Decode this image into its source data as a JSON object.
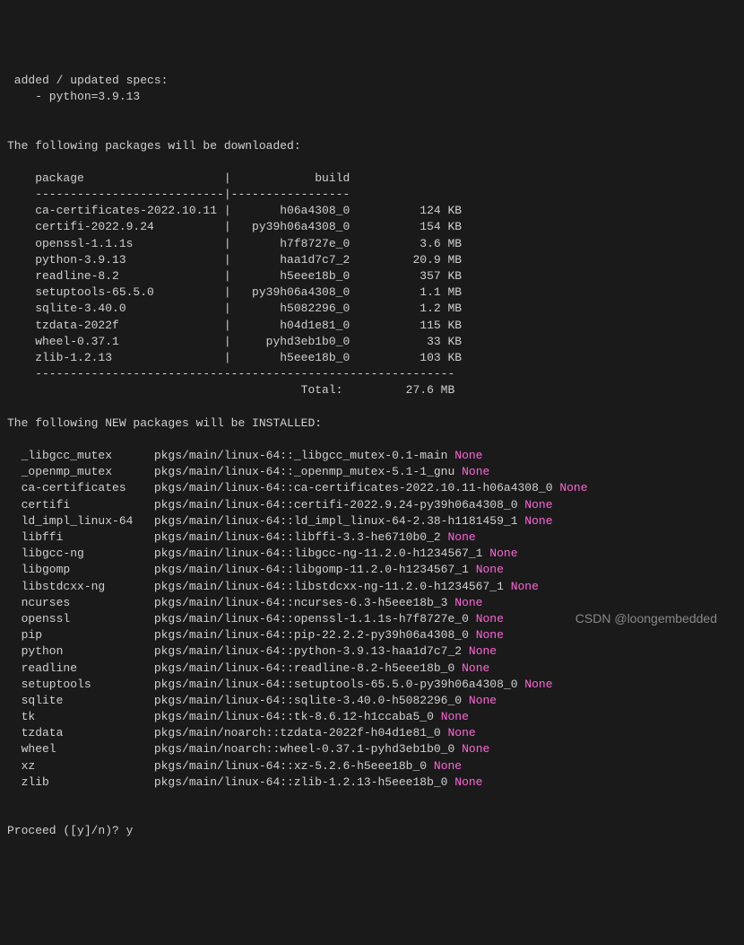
{
  "header": {
    "specs_line": " added / updated specs:",
    "spec_item": "    - python=3.9.13"
  },
  "download": {
    "intro": "The following packages will be downloaded:",
    "col_package": "    package",
    "col_build": "build",
    "dash_left": "    ---------------------------",
    "dash_right": "-----------------",
    "rows": [
      {
        "pkg": "    ca-certificates-2022.10.11",
        "build": "h06a4308_0",
        "size": "124 KB"
      },
      {
        "pkg": "    certifi-2022.9.24",
        "build": "py39h06a4308_0",
        "size": "154 KB"
      },
      {
        "pkg": "    openssl-1.1.1s",
        "build": "h7f8727e_0",
        "size": "3.6 MB"
      },
      {
        "pkg": "    python-3.9.13",
        "build": "haa1d7c7_2",
        "size": "20.9 MB"
      },
      {
        "pkg": "    readline-8.2",
        "build": "h5eee18b_0",
        "size": "357 KB"
      },
      {
        "pkg": "    setuptools-65.5.0",
        "build": "py39h06a4308_0",
        "size": "1.1 MB"
      },
      {
        "pkg": "    sqlite-3.40.0",
        "build": "h5082296_0",
        "size": "1.2 MB"
      },
      {
        "pkg": "    tzdata-2022f",
        "build": "h04d1e81_0",
        "size": "115 KB"
      },
      {
        "pkg": "    wheel-0.37.1",
        "build": "pyhd3eb1b0_0",
        "size": "33 KB"
      },
      {
        "pkg": "    zlib-1.2.13",
        "build": "h5eee18b_0",
        "size": "103 KB"
      }
    ],
    "bottom_dash": "    ------------------------------------------------------------",
    "total_label": "Total:",
    "total_value": "27.6 MB"
  },
  "install": {
    "intro": "The following NEW packages will be INSTALLED:",
    "rows": [
      {
        "name": "  _libgcc_mutex",
        "src": "pkgs/main/linux-64::_libgcc_mutex-0.1-main",
        "tag": "None"
      },
      {
        "name": "  _openmp_mutex",
        "src": "pkgs/main/linux-64::_openmp_mutex-5.1-1_gnu",
        "tag": "None"
      },
      {
        "name": "  ca-certificates",
        "src": "pkgs/main/linux-64::ca-certificates-2022.10.11-h06a4308_0",
        "tag": "None"
      },
      {
        "name": "  certifi",
        "src": "pkgs/main/linux-64::certifi-2022.9.24-py39h06a4308_0",
        "tag": "None"
      },
      {
        "name": "  ld_impl_linux-64",
        "src": "pkgs/main/linux-64::ld_impl_linux-64-2.38-h1181459_1",
        "tag": "None"
      },
      {
        "name": "  libffi",
        "src": "pkgs/main/linux-64::libffi-3.3-he6710b0_2",
        "tag": "None"
      },
      {
        "name": "  libgcc-ng",
        "src": "pkgs/main/linux-64::libgcc-ng-11.2.0-h1234567_1",
        "tag": "None"
      },
      {
        "name": "  libgomp",
        "src": "pkgs/main/linux-64::libgomp-11.2.0-h1234567_1",
        "tag": "None"
      },
      {
        "name": "  libstdcxx-ng",
        "src": "pkgs/main/linux-64::libstdcxx-ng-11.2.0-h1234567_1",
        "tag": "None"
      },
      {
        "name": "  ncurses",
        "src": "pkgs/main/linux-64::ncurses-6.3-h5eee18b_3",
        "tag": "None"
      },
      {
        "name": "  openssl",
        "src": "pkgs/main/linux-64::openssl-1.1.1s-h7f8727e_0",
        "tag": "None"
      },
      {
        "name": "  pip",
        "src": "pkgs/main/linux-64::pip-22.2.2-py39h06a4308_0",
        "tag": "None"
      },
      {
        "name": "  python",
        "src": "pkgs/main/linux-64::python-3.9.13-haa1d7c7_2",
        "tag": "None"
      },
      {
        "name": "  readline",
        "src": "pkgs/main/linux-64::readline-8.2-h5eee18b_0",
        "tag": "None"
      },
      {
        "name": "  setuptools",
        "src": "pkgs/main/linux-64::setuptools-65.5.0-py39h06a4308_0",
        "tag": "None"
      },
      {
        "name": "  sqlite",
        "src": "pkgs/main/linux-64::sqlite-3.40.0-h5082296_0",
        "tag": "None"
      },
      {
        "name": "  tk",
        "src": "pkgs/main/linux-64::tk-8.6.12-h1ccaba5_0",
        "tag": "None"
      },
      {
        "name": "  tzdata",
        "src": "pkgs/main/noarch::tzdata-2022f-h04d1e81_0",
        "tag": "None"
      },
      {
        "name": "  wheel",
        "src": "pkgs/main/noarch::wheel-0.37.1-pyhd3eb1b0_0",
        "tag": "None"
      },
      {
        "name": "  xz",
        "src": "pkgs/main/linux-64::xz-5.2.6-h5eee18b_0",
        "tag": "None"
      },
      {
        "name": "  zlib",
        "src": "pkgs/main/linux-64::zlib-1.2.13-h5eee18b_0",
        "tag": "None"
      }
    ]
  },
  "prompt": {
    "question": "Proceed ([y]/n)? ",
    "answer": "y"
  },
  "watermark": "CSDN @loongembedded"
}
